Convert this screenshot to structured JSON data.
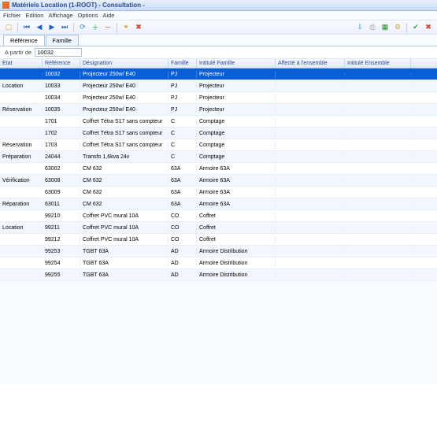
{
  "window": {
    "title": "Matériels Location (1-ROOT) - Consultation -"
  },
  "menu": {
    "fichier": "Fichier",
    "edition": "Edition",
    "affichage": "Affichage",
    "options": "Options",
    "aide": "Aide"
  },
  "tabs": {
    "reference": "Référence",
    "famille": "Famille"
  },
  "filter": {
    "label": "A partir de",
    "value": "10032"
  },
  "columns": {
    "etat": "Etat",
    "reference": "Référence",
    "designation": "Désignation",
    "famille": "Famille",
    "intitule_famille": "Intitulé Famille",
    "affecte": "Affecté à l'ensemble",
    "intitule_ensemble": "Intitulé Ensemble"
  },
  "rows": [
    {
      "etat": "",
      "ref": "10032",
      "desig": "Projecteur 250w/ E40",
      "fam": "PJ",
      "intfam": "Projecteur",
      "aff": "",
      "intens": "",
      "selected": true
    },
    {
      "etat": "Location",
      "ref": "10033",
      "desig": "Projecteur 250w/ E40",
      "fam": "PJ",
      "intfam": "Projecteur",
      "aff": "",
      "intens": "",
      "selected": false
    },
    {
      "etat": "",
      "ref": "10034",
      "desig": "Projecteur 250w/ E40",
      "fam": "PJ",
      "intfam": "Projecteur",
      "aff": "",
      "intens": "",
      "selected": false
    },
    {
      "etat": "Réservation",
      "ref": "10035",
      "desig": "Projecteur 250w/ E40",
      "fam": "PJ",
      "intfam": "Projecteur",
      "aff": "",
      "intens": "",
      "selected": false
    },
    {
      "etat": "",
      "ref": "1701",
      "desig": "Coffret Tétra S17 sans compteur",
      "fam": "C",
      "intfam": "Comptage",
      "aff": "",
      "intens": "",
      "selected": false
    },
    {
      "etat": "",
      "ref": "1702",
      "desig": "Coffret Tétra S17 sans compteur",
      "fam": "C",
      "intfam": "Comptage",
      "aff": "",
      "intens": "",
      "selected": false
    },
    {
      "etat": "Réservation",
      "ref": "1703",
      "desig": "Coffret Tétra S17 sans compteur",
      "fam": "C",
      "intfam": "Comptage",
      "aff": "",
      "intens": "",
      "selected": false
    },
    {
      "etat": "Préparation",
      "ref": "24044",
      "desig": "Transfo 1,6kva 24v",
      "fam": "C",
      "intfam": "Comptage",
      "aff": "",
      "intens": "",
      "selected": false
    },
    {
      "etat": "",
      "ref": "63002",
      "desig": "CM 632",
      "fam": "63A",
      "intfam": "Armoire 63A",
      "aff": "",
      "intens": "",
      "selected": false
    },
    {
      "etat": "Vérification",
      "ref": "63008",
      "desig": "CM 632",
      "fam": "63A",
      "intfam": "Armoire 63A",
      "aff": "",
      "intens": "",
      "selected": false
    },
    {
      "etat": "",
      "ref": "63009",
      "desig": "CM 632",
      "fam": "63A",
      "intfam": "Armoire 63A",
      "aff": "",
      "intens": "",
      "selected": false
    },
    {
      "etat": "Réparation",
      "ref": "63011",
      "desig": "CM 632",
      "fam": "63A",
      "intfam": "Armoire 63A",
      "aff": "",
      "intens": "",
      "selected": false
    },
    {
      "etat": "",
      "ref": "99210",
      "desig": "Coffret PVC mural 10A",
      "fam": "CO",
      "intfam": "Coffret",
      "aff": "",
      "intens": "",
      "selected": false
    },
    {
      "etat": "Location",
      "ref": "99211",
      "desig": "Coffret PVC mural 10A",
      "fam": "CO",
      "intfam": "Coffret",
      "aff": "",
      "intens": "",
      "selected": false
    },
    {
      "etat": "",
      "ref": "99212",
      "desig": "Coffret PVC mural 10A",
      "fam": "CO",
      "intfam": "Coffret",
      "aff": "",
      "intens": "",
      "selected": false
    },
    {
      "etat": "",
      "ref": "99253",
      "desig": "TGBT 63A",
      "fam": "AD",
      "intfam": "Armoire Distribution",
      "aff": "",
      "intens": "",
      "selected": false
    },
    {
      "etat": "",
      "ref": "99254",
      "desig": "TGBT 63A",
      "fam": "AD",
      "intfam": "Armoire Distribution",
      "aff": "",
      "intens": "",
      "selected": false
    },
    {
      "etat": "",
      "ref": "99255",
      "desig": "TGBT 63A",
      "fam": "AD",
      "intfam": "Armoire Distribution",
      "aff": "",
      "intens": "",
      "selected": false
    }
  ]
}
